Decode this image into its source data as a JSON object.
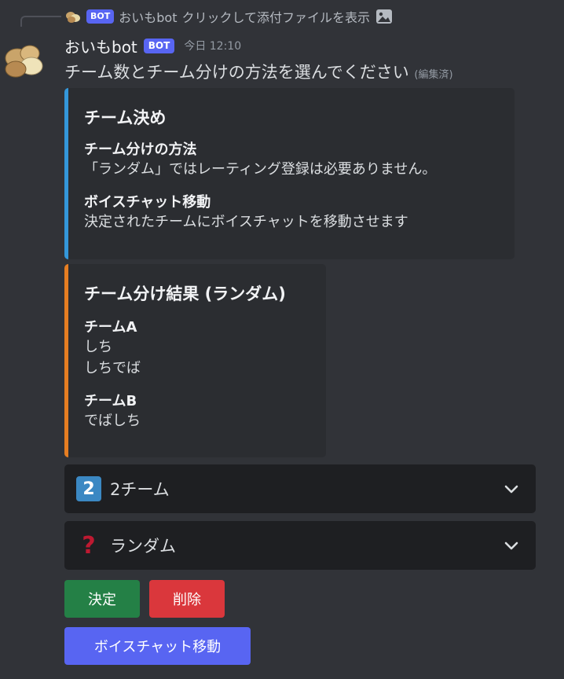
{
  "reply": {
    "username": "おいもbot",
    "badge": "BOT",
    "text": "クリックして添付ファイルを表示"
  },
  "message": {
    "username": "おいもbot",
    "badge": "BOT",
    "timestamp": "今日 12:10",
    "content": "チーム数とチーム分けの方法を選んでください",
    "edited": "(編集済)"
  },
  "embeds": [
    {
      "color": "#3497da",
      "title": "チーム決め",
      "fields": [
        {
          "name": "チーム分けの方法",
          "value": "「ランダム」ではレーティング登録は必要ありません。"
        },
        {
          "name": "ボイスチャット移動",
          "value": "決定されたチームにボイスチャットを移動させます"
        }
      ]
    },
    {
      "color": "#e67e22",
      "title": "チーム分け結果 (ランダム)",
      "fields": [
        {
          "name": "チームA",
          "values": [
            "しち",
            "しちでば"
          ]
        },
        {
          "name": "チームB",
          "values": [
            "でばしち"
          ]
        }
      ]
    }
  ],
  "selects": [
    {
      "emoji_text": "2",
      "emoji_icon": "keycap-two-icon",
      "label": "2チーム"
    },
    {
      "emoji_text": "?",
      "emoji_icon": "red-question-mark-icon",
      "label": "ランダム"
    }
  ],
  "buttons": {
    "decide": "決定",
    "delete": "削除",
    "voice_move": "ボイスチャット移動"
  },
  "colors": {
    "background": "#313338",
    "embed_bg": "#2b2d31",
    "select_bg": "#1e1f22",
    "success": "#248046",
    "danger": "#da373c",
    "primary": "#5865f2"
  }
}
